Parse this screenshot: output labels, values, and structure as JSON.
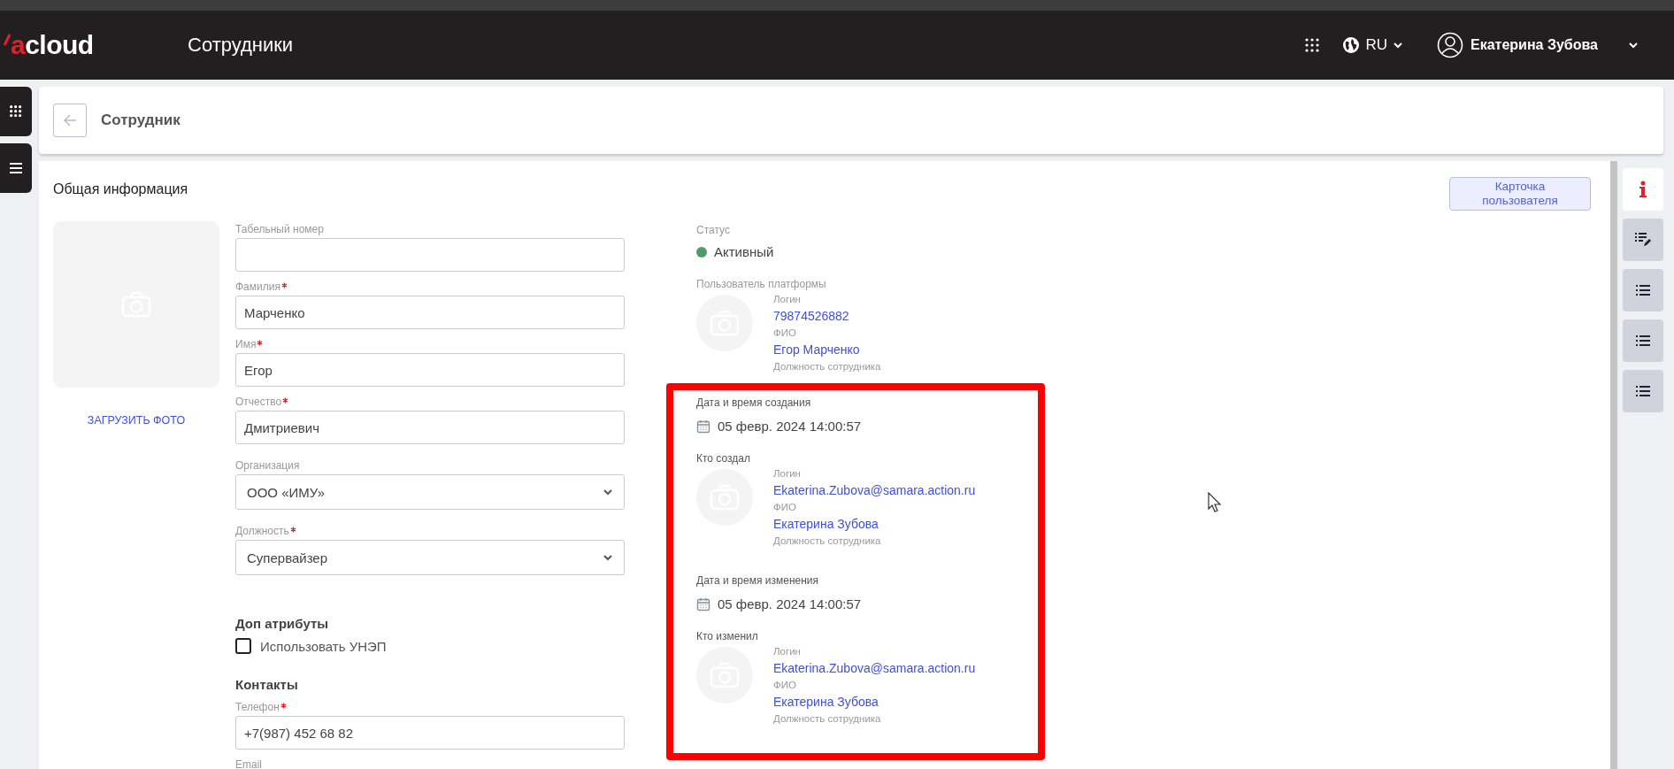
{
  "header": {
    "logo": "acloud",
    "title": "Сотрудники",
    "language": "RU",
    "user_name": "Екатерина Зубова"
  },
  "page": {
    "title": "Сотрудник"
  },
  "card": {
    "title": "Общая информация",
    "user_card_button": "Карточка пользователя",
    "upload_photo": "ЗАГРУЗИТЬ ФОТО"
  },
  "form": {
    "fields": [
      {
        "kind": "text",
        "label": "Табельный номер",
        "required": false
      },
      {
        "kind": "text",
        "label": "Фамилия",
        "required": true,
        "value": "Марченко"
      },
      {
        "kind": "text",
        "label": "Имя",
        "required": true,
        "value": "Егор"
      },
      {
        "kind": "text",
        "label": "Отчество",
        "required": true,
        "value": "Дмитриевич"
      },
      {
        "kind": "select",
        "label": "Организация",
        "required": false,
        "value": "ООО «ИМУ»"
      },
      {
        "kind": "select",
        "label": "Должность",
        "required": true,
        "value": "Супервайзер"
      }
    ],
    "extras": {
      "title": "Доп атрибуты",
      "checkbox": {
        "label": "Использовать УНЭП",
        "checked": false
      }
    },
    "contacts": {
      "title": "Контакты",
      "fields": [
        {
          "kind": "text",
          "label": "Телефон",
          "required": true,
          "value": "+7(987) 452 68 82"
        },
        {
          "kind": "label",
          "label": "Email",
          "required": false
        }
      ]
    }
  },
  "status": {
    "label": "Статус",
    "value": "Активный",
    "color": "#4f9a6a"
  },
  "platform_user": {
    "label": "Пользователь платформы",
    "login_label": "Логин",
    "login": "79874526882",
    "name_label": "ФИО",
    "name": "Егор Марченко",
    "position_label": "Должность сотрудника"
  },
  "audit": {
    "highlighted": true,
    "entries": [
      {
        "date_label": "Дата и время создания",
        "date": "05 февр. 2024 14:00:57",
        "who_label": "Кто создал",
        "login_label": "Логин",
        "login": "Ekaterina.Zubova@samara.action.ru",
        "name_label": "ФИО",
        "name": "Екатерина Зубова",
        "position_label": "Должность сотрудника"
      },
      {
        "date_label": "Дата и время изменения",
        "date": "05 февр. 2024 14:00:57",
        "who_label": "Кто изменил",
        "login_label": "Логин",
        "login": "Ekaterina.Zubova@samara.action.ru",
        "name_label": "ФИО",
        "name": "Екатерина Зубова",
        "position_label": "Должность сотрудника"
      }
    ]
  },
  "side_tabs": [
    {
      "kind": "info",
      "selected": true
    },
    {
      "kind": "edit",
      "selected": false
    },
    {
      "kind": "list",
      "selected": false
    },
    {
      "kind": "list",
      "selected": false
    },
    {
      "kind": "list",
      "selected": false
    }
  ]
}
